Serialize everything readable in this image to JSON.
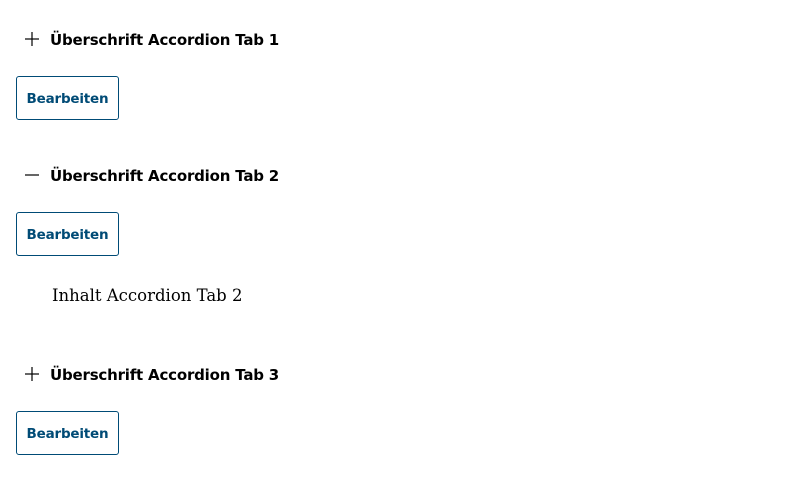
{
  "accordion": {
    "tabs": [
      {
        "title": "Überschrift Accordion Tab 1",
        "expanded": false,
        "icon": "plus-icon",
        "edit_label": "Bearbeiten",
        "content": ""
      },
      {
        "title": "Überschrift Accordion Tab 2",
        "expanded": true,
        "icon": "minus-icon",
        "edit_label": "Bearbeiten",
        "content": "Inhalt Accordion Tab 2"
      },
      {
        "title": "Überschrift Accordion Tab 3",
        "expanded": false,
        "icon": "plus-icon",
        "edit_label": "Bearbeiten",
        "content": ""
      }
    ]
  },
  "colors": {
    "button_border": "#004b76",
    "button_text": "#004b76",
    "header_text": "#000000"
  }
}
